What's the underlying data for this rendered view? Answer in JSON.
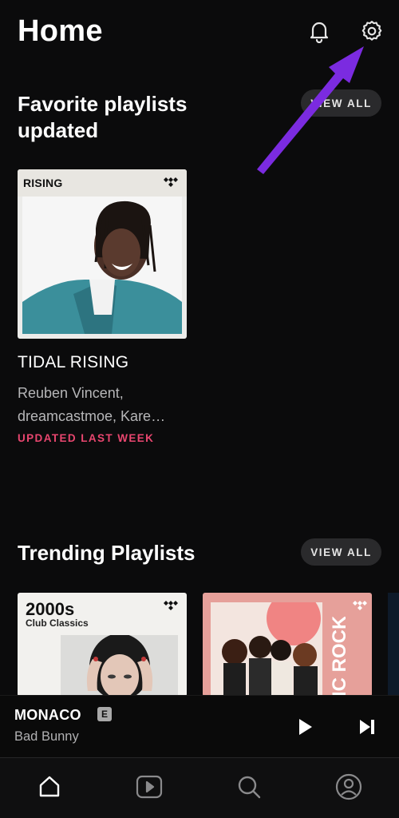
{
  "header": {
    "title": "Home",
    "notifications_icon": "bell-icon",
    "settings_icon": "gear-icon"
  },
  "favorites": {
    "title": "Favorite playlists updated",
    "view_all_label": "VIEW ALL",
    "items": [
      {
        "art_label": "RISING",
        "name": "TIDAL RISING",
        "artists": "Reuben Vincent, dreamcastmoe, Kare…",
        "updated": "UPDATED LAST WEEK"
      }
    ]
  },
  "trending": {
    "title": "Trending Playlists",
    "view_all_label": "VIEW ALL",
    "items": [
      {
        "art_title": "2000s",
        "art_subtitle": "Club Classics"
      },
      {
        "art_title": "IC ROCK ICS"
      }
    ]
  },
  "now_playing": {
    "title": "MONACO",
    "explicit_badge": "E",
    "artist": "Bad Bunny",
    "play_icon": "play-icon",
    "next_icon": "skip-next-icon"
  },
  "tabs": [
    {
      "name": "Home",
      "icon": "home-icon",
      "active": true
    },
    {
      "name": "Videos",
      "icon": "video-icon",
      "active": false
    },
    {
      "name": "Search",
      "icon": "search-icon",
      "active": false
    },
    {
      "name": "My Collection",
      "icon": "profile-icon",
      "active": false
    }
  ],
  "colors": {
    "background": "#0b0b0c",
    "accent_updated": "#e9466f",
    "annotation_arrow": "#7b2be0",
    "pill_background": "#2a2a2c"
  }
}
